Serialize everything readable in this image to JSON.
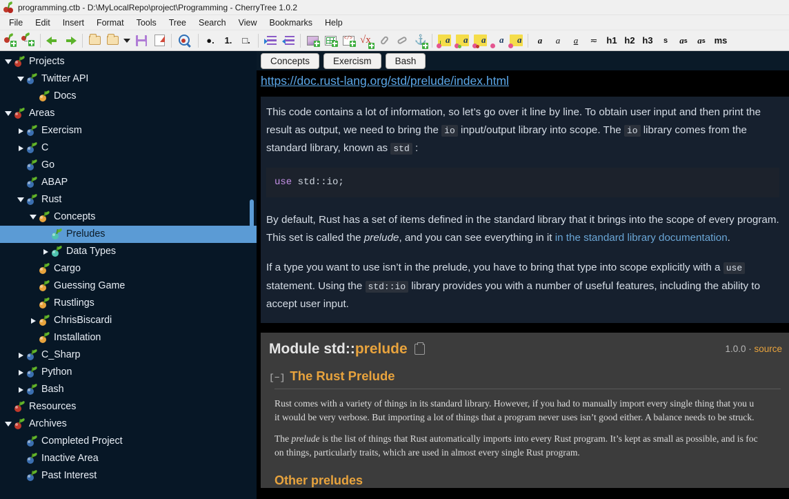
{
  "window": {
    "title": "programming.ctb - D:\\MyLocalRepo\\project\\Programming - CherryTree 1.0.2",
    "app_icon": "cherry-icon"
  },
  "menubar": {
    "items": [
      "File",
      "Edit",
      "Insert",
      "Format",
      "Tools",
      "Tree",
      "Search",
      "View",
      "Bookmarks",
      "Help"
    ]
  },
  "toolbar": {
    "groups": [
      {
        "buttons": [
          {
            "name": "add-node-button",
            "icon": "cherry-plus-icon",
            "label": ""
          },
          {
            "name": "add-subnode-button",
            "icon": "cherry-subnode-plus-icon",
            "label": ""
          }
        ]
      },
      {
        "buttons": [
          {
            "name": "go-back-button",
            "icon": "arrow-left-icon",
            "label": ""
          },
          {
            "name": "go-forward-button",
            "icon": "arrow-right-icon",
            "label": ""
          }
        ]
      },
      {
        "buttons": [
          {
            "name": "open-file-button",
            "icon": "folder-icon",
            "label": ""
          },
          {
            "name": "recent-documents-button",
            "icon": "folder-icon",
            "label": ""
          },
          {
            "name": "recent-documents-dropdown",
            "icon": "chevron-down-icon",
            "label": ""
          },
          {
            "name": "save-button",
            "icon": "floppy-disk-icon",
            "label": ""
          },
          {
            "name": "export-pdf-button",
            "icon": "export-document-icon",
            "label": ""
          }
        ]
      },
      {
        "buttons": [
          {
            "name": "find-button",
            "icon": "magnifier-cherry-icon",
            "label": ""
          }
        ]
      },
      {
        "buttons": [
          {
            "name": "bulleted-list-button",
            "icon": "bullet-list-icon",
            "label": "●."
          },
          {
            "name": "numbered-list-button",
            "icon": "numbered-list-icon",
            "label": "1."
          },
          {
            "name": "todo-list-button",
            "icon": "todo-list-icon",
            "label": "□."
          }
        ]
      },
      {
        "buttons": [
          {
            "name": "increase-indent-button",
            "icon": "indent-increase-icon",
            "label": ""
          },
          {
            "name": "decrease-indent-button",
            "icon": "indent-decrease-icon",
            "label": ""
          }
        ]
      },
      {
        "buttons": [
          {
            "name": "insert-image-button",
            "icon": "insert-image-icon",
            "label": ""
          },
          {
            "name": "insert-table-button",
            "icon": "insert-table-icon",
            "label": ""
          },
          {
            "name": "insert-codebox-button",
            "icon": "insert-codebox-icon",
            "label": ""
          },
          {
            "name": "insert-latex-button",
            "icon": "insert-formula-icon",
            "label": ""
          },
          {
            "name": "attach-file-button",
            "icon": "paperclip-icon",
            "label": ""
          },
          {
            "name": "insert-link-button",
            "icon": "link-icon",
            "label": ""
          },
          {
            "name": "insert-anchor-button",
            "icon": "anchor-plus-icon",
            "label": ""
          }
        ]
      },
      {
        "buttons": [
          {
            "name": "foreground-color-button",
            "icon": "text-color-icon",
            "label": "a"
          },
          {
            "name": "background-color-button",
            "icon": "text-highlight-icon",
            "label": "a"
          },
          {
            "name": "remove-formatting-button",
            "icon": "clear-formatting-icon",
            "label": "a"
          },
          {
            "name": "text-color-picker-button",
            "icon": "color-picker-icon",
            "label": "a"
          },
          {
            "name": "highlight-color-button",
            "icon": "highlight-color-icon",
            "label": "a"
          }
        ]
      },
      {
        "buttons": [
          {
            "name": "bold-button",
            "icon": "bold-icon",
            "label": "a"
          },
          {
            "name": "italic-button",
            "icon": "italic-icon",
            "label": "a"
          },
          {
            "name": "underline-button",
            "icon": "underline-icon",
            "label": "a"
          },
          {
            "name": "strikethrough-button",
            "icon": "strikethrough-icon",
            "label": "≂"
          },
          {
            "name": "heading-1-button",
            "icon": "h1-icon",
            "label": "h1"
          },
          {
            "name": "heading-2-button",
            "icon": "h2-icon",
            "label": "h2"
          },
          {
            "name": "heading-3-button",
            "icon": "h3-icon",
            "label": "h3"
          },
          {
            "name": "small-text-button",
            "icon": "small-text-icon",
            "label": "s"
          },
          {
            "name": "superscript-button",
            "icon": "superscript-icon",
            "label": "a"
          },
          {
            "name": "subscript-button",
            "icon": "subscript-icon",
            "label": "a"
          },
          {
            "name": "monospace-button",
            "icon": "monospace-icon",
            "label": "ms"
          }
        ]
      }
    ]
  },
  "tree": {
    "selected": "Preludes",
    "nodes": [
      {
        "label": "Projects",
        "depth": 0,
        "twist": "down",
        "cherry": "red"
      },
      {
        "label": "Twitter API",
        "depth": 1,
        "twist": "down",
        "cherry": "blue"
      },
      {
        "label": "Docs",
        "depth": 2,
        "twist": "none",
        "cherry": "orange"
      },
      {
        "label": "Areas",
        "depth": 0,
        "twist": "down",
        "cherry": "red"
      },
      {
        "label": "Exercism",
        "depth": 1,
        "twist": "right",
        "cherry": "blue"
      },
      {
        "label": "C",
        "depth": 1,
        "twist": "right",
        "cherry": "blue"
      },
      {
        "label": "Go",
        "depth": 1,
        "twist": "none",
        "cherry": "blue"
      },
      {
        "label": "ABAP",
        "depth": 1,
        "twist": "none",
        "cherry": "blue"
      },
      {
        "label": "Rust",
        "depth": 1,
        "twist": "down",
        "cherry": "blue"
      },
      {
        "label": "Concepts",
        "depth": 2,
        "twist": "down",
        "cherry": "orange"
      },
      {
        "label": "Preludes",
        "depth": 3,
        "twist": "none",
        "cherry": "teal",
        "selected": true
      },
      {
        "label": "Data Types",
        "depth": 3,
        "twist": "right",
        "cherry": "teal"
      },
      {
        "label": "Cargo",
        "depth": 2,
        "twist": "none",
        "cherry": "orange"
      },
      {
        "label": "Guessing Game",
        "depth": 2,
        "twist": "none",
        "cherry": "orange"
      },
      {
        "label": "Rustlings",
        "depth": 2,
        "twist": "none",
        "cherry": "orange"
      },
      {
        "label": "ChrisBiscardi",
        "depth": 2,
        "twist": "right",
        "cherry": "orange"
      },
      {
        "label": "Installation",
        "depth": 2,
        "twist": "none",
        "cherry": "orange"
      },
      {
        "label": "C_Sharp",
        "depth": 1,
        "twist": "right",
        "cherry": "blue"
      },
      {
        "label": "Python",
        "depth": 1,
        "twist": "right",
        "cherry": "blue"
      },
      {
        "label": "Bash",
        "depth": 1,
        "twist": "right",
        "cherry": "blue"
      },
      {
        "label": "Resources",
        "depth": 0,
        "twist": "none",
        "cherry": "red"
      },
      {
        "label": "Archives",
        "depth": 0,
        "twist": "down",
        "cherry": "red"
      },
      {
        "label": "Completed Project",
        "depth": 1,
        "twist": "none",
        "cherry": "blue"
      },
      {
        "label": "Inactive Area",
        "depth": 1,
        "twist": "none",
        "cherry": "blue"
      },
      {
        "label": "Past Interest",
        "depth": 1,
        "twist": "none",
        "cherry": "blue"
      }
    ]
  },
  "bookmarks": {
    "buttons": [
      "Concepts",
      "Exercism",
      "Bash"
    ]
  },
  "note": {
    "url": "https://doc.rust-lang.org/std/prelude/index.html",
    "para1": {
      "t1": "This code contains a lot of information, so let’s go over it line by line. To obtain user input and then print the result as output, we need to bring the ",
      "c1": "io",
      "t2": " input/output library into scope. The ",
      "c2": "io",
      "t3": " library comes from the standard library, known as ",
      "c3": "std",
      "t4": " :"
    },
    "codeblock": {
      "keyword": "use",
      "rest": " std::io;"
    },
    "para2": {
      "t1": "By default, Rust has a set of items defined in the standard library that it brings into the scope of every program. This set is called the ",
      "em1": "prelude",
      "t2": ", and you can see everything in it ",
      "link": "in the standard library documentation",
      "t3": "."
    },
    "para3": {
      "t1": "If a type you want to use isn’t in the prelude, you have to bring that type into scope explicitly with a ",
      "c1": "use",
      "t2": " statement. Using the ",
      "c2": "std::io",
      "t3": " library provides you with a number of useful features, including the ability to accept user input."
    }
  },
  "rustdoc": {
    "title_prefix": "Module std::",
    "title_accent": "prelude",
    "copy_icon": "copy-path-icon",
    "version": "1.0.0 · ",
    "source_link": "source",
    "section_toggle": "[−]",
    "heading": "The Rust Prelude",
    "para1_line1": "Rust comes with a variety of things in its standard library. However, if you had to manually import every single thing that you u",
    "para1_line2": "it would be very verbose. But importing a lot of things that a program never uses isn’t good either. A balance needs to be struck.",
    "para2_line1_a": "The ",
    "para2_line1_em": "prelude",
    "para2_line1_b": " is the list of things that Rust automatically imports into every Rust program. It’s kept as small as possible, and is foc",
    "para2_line2": "on things, particularly traits, which are used in almost every single Rust program.",
    "heading2": "Other preludes"
  },
  "colors": {
    "tree_bg": "#071726",
    "selection": "#5b9bd5",
    "accent_orange": "#e8a33d",
    "link_blue": "#5ba7e8",
    "card_bg": "#16202e",
    "rustdoc_bg": "#3c3c3c"
  }
}
